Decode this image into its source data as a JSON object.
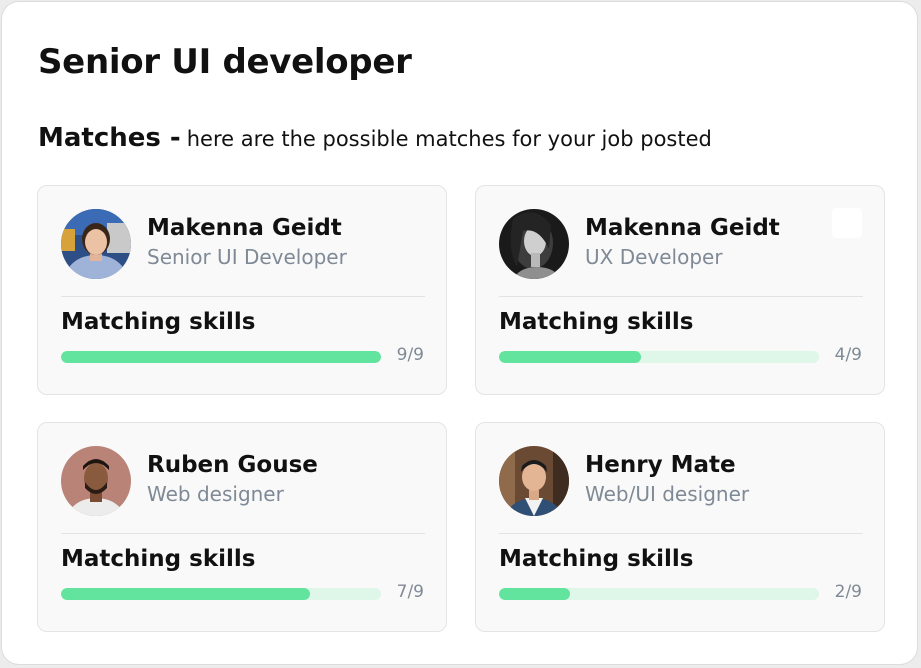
{
  "job": {
    "title": "Senior UI developer"
  },
  "matches": {
    "heading": "Matches -",
    "description": "here are the possible matches for your job posted"
  },
  "candidates": [
    {
      "name": "Makenna Geidt",
      "role": "Senior UI Developer",
      "skills_label": "Matching skills",
      "matched": 9,
      "total": 9,
      "count_text": "9/9"
    },
    {
      "name": "Makenna Geidt",
      "role": "UX Developer",
      "skills_label": "Matching skills",
      "matched": 4,
      "total": 9,
      "count_text": "4/9"
    },
    {
      "name": "Ruben Gouse",
      "role": "Web designer",
      "skills_label": "Matching skills",
      "matched": 7,
      "total": 9,
      "count_text": "7/9"
    },
    {
      "name": "Henry Mate",
      "role": "Web/UI designer",
      "skills_label": "Matching skills",
      "matched": 2,
      "total": 9,
      "count_text": "2/9"
    }
  ],
  "colors": {
    "progress_fill": "#62e39e",
    "progress_track": "#dff7e9",
    "secondary_text": "#7f8a96"
  }
}
